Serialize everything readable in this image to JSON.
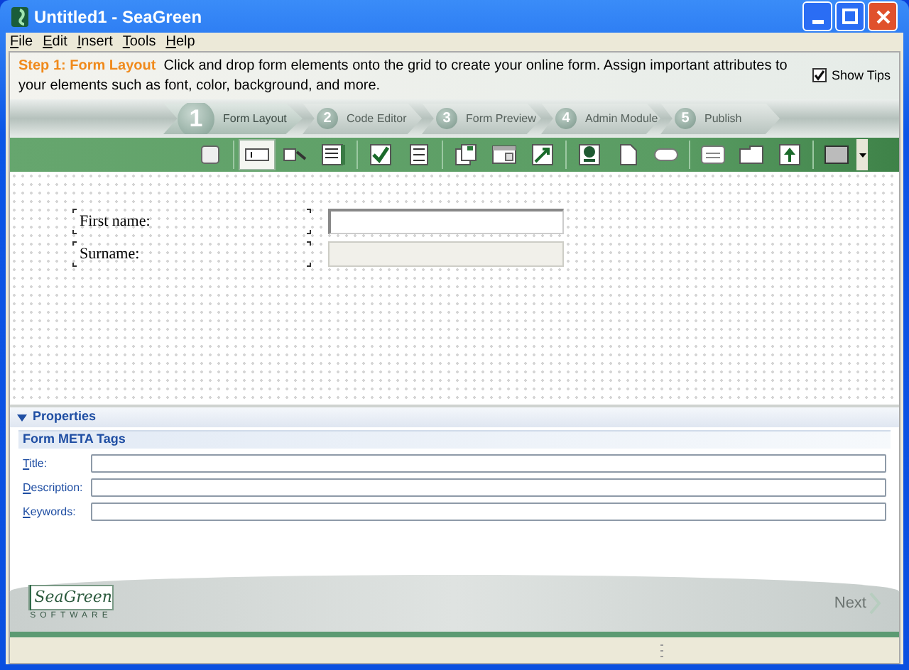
{
  "window": {
    "title": "Untitled1 - SeaGreen"
  },
  "menu": [
    "File",
    "Edit",
    "Insert",
    "Tools",
    "Help"
  ],
  "tip": {
    "heading": "Step 1: Form Layout",
    "text": "Click and drop form elements onto the grid to create your online form.  Assign important attributes to your elements such as font, color, background, and more.",
    "show_tips": {
      "label": "Show Tips",
      "checked": true
    }
  },
  "steps": [
    {
      "number": "1",
      "label": "Form Layout",
      "selected": true
    },
    {
      "number": "2",
      "label": "Code Editor",
      "selected": false
    },
    {
      "number": "3",
      "label": "Form Preview",
      "selected": false
    },
    {
      "number": "4",
      "label": "Admin Module",
      "selected": false
    },
    {
      "number": "5",
      "label": "Publish",
      "selected": false
    }
  ],
  "toolbar": [
    {
      "kind": "blank",
      "selected": false
    },
    {
      "kind": "textbox",
      "selected": true
    },
    {
      "kind": "label",
      "selected": false
    },
    {
      "kind": "listbox",
      "selected": false
    },
    {
      "kind": "check",
      "selected": false
    },
    {
      "kind": "list",
      "selected": false
    },
    {
      "kind": "docs",
      "selected": false
    },
    {
      "kind": "window",
      "selected": false
    },
    {
      "kind": "arrow",
      "selected": false
    },
    {
      "kind": "stamp",
      "selected": false
    },
    {
      "kind": "page",
      "selected": false
    },
    {
      "kind": "pill",
      "selected": false
    },
    {
      "kind": "abc",
      "selected": false
    },
    {
      "kind": "tab",
      "selected": false
    },
    {
      "kind": "upload",
      "selected": false
    },
    {
      "kind": "color",
      "selected": false
    }
  ],
  "form": [
    {
      "label": "First name:",
      "focused": true
    },
    {
      "label": "Surname:",
      "focused": false
    }
  ],
  "properties": {
    "title": "Properties",
    "section": "Form META Tags",
    "fields": [
      {
        "label": "Title:"
      },
      {
        "label": "Description:"
      },
      {
        "label": "Keywords:"
      }
    ]
  },
  "footer": {
    "logo_name": "SeaGreen",
    "logo_sub": "SOFTWARE",
    "next": "Next"
  }
}
